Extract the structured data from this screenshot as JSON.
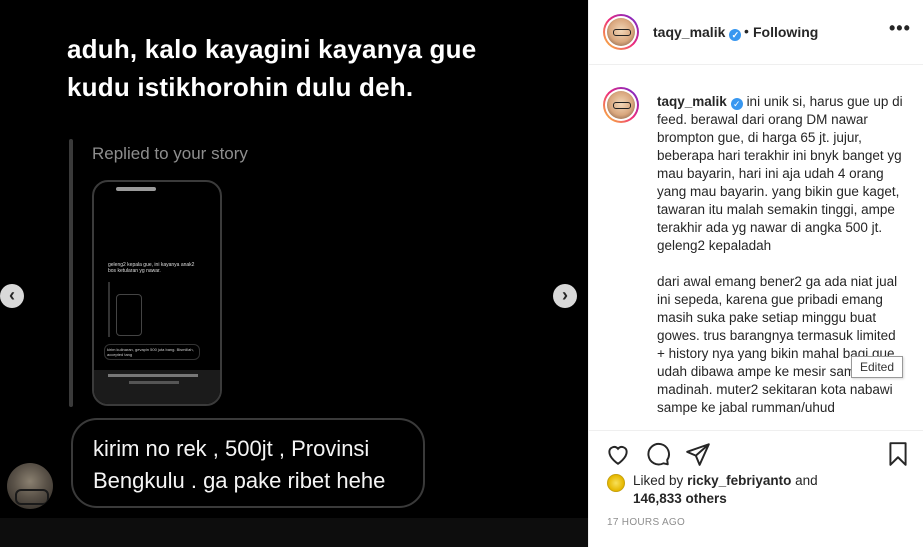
{
  "media": {
    "story_reply_text": "aduh, kalo kayagini kayanya gue kudu istikhorohin dulu deh.",
    "replied_label": "Replied to your story",
    "phone_preview_text": "geleng2 kepala gue, ini kayanya anak2 bos ketularan yg nawar.",
    "phone_bubble_text": "kirim kulinaran, gevapin 500 juta bang. Bismillah, accepted tang",
    "message_text": "kirim no rek , 500jt , Provinsi Bengkulu . ga pake ribet hehe",
    "prev_icon": "chevron-left-icon",
    "next_icon": "chevron-right-icon"
  },
  "header": {
    "username": "taqy_malik",
    "separator": "•",
    "follow_status": "Following",
    "more_label": "•••"
  },
  "caption": {
    "username": "taqy_malik",
    "paragraph1": "ini unik si, harus gue up di feed. berawal dari orang DM nawar brompton gue, di harga 65 jt. jujur, beberapa hari terakhir ini bnyk banget yg mau bayarin, hari ini aja udah 4 orang yang mau bayarin. yang bikin gue kaget, tawaran itu malah semakin tinggi, ampe terakhir ada yg nawar di angka 500 jt. geleng2 kepaladah",
    "paragraph2": "dari awal emang bener2 ga ada niat jual ini sepeda, karena gue pribadi emang masih suka pake setiap minggu buat gowes. trus barangnya termasuk limited + history nya yang bikin mahal bagi gue. udah dibawa ampe ke mesir sama madinah. muter2 sekitaran kota nabawi sampe ke jabal rumman/uhud",
    "edited_tooltip": "Edited"
  },
  "actions": {
    "like_icon": "heart-icon",
    "comment_icon": "comment-icon",
    "share_icon": "share-icon",
    "save_icon": "bookmark-icon"
  },
  "likes": {
    "prefix": "Liked by",
    "user": "ricky_febriyanto",
    "and": "and",
    "count": "146,833 others"
  },
  "timestamp": "17 HOURS AGO",
  "colors": {
    "verified": "#3897f0",
    "text": "#262626",
    "muted": "#8e8e8e"
  }
}
